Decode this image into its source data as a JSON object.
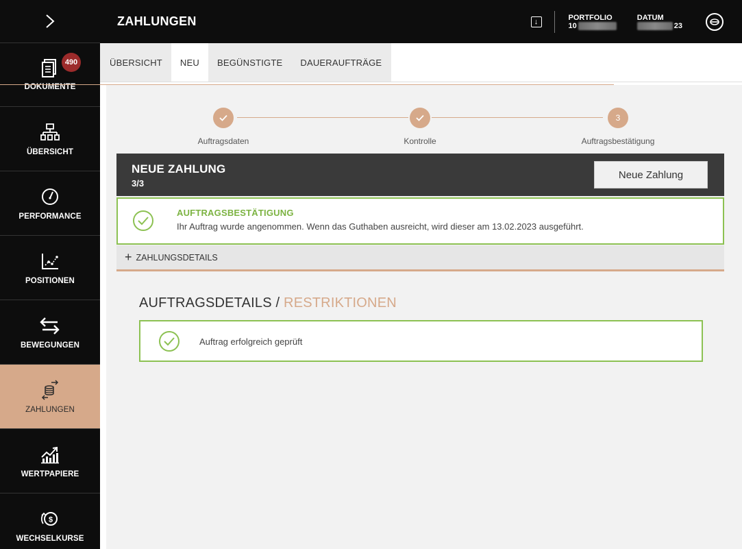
{
  "app": {
    "section_title": "ZAHLUNGEN"
  },
  "sidebar": {
    "badge_count": "490",
    "items": [
      {
        "label": "DOKUMENTE",
        "icon": "document-icon"
      },
      {
        "label": "ÜBERSICHT",
        "icon": "hierarchy-icon"
      },
      {
        "label": "PERFORMANCE",
        "icon": "gauge-icon"
      },
      {
        "label": "POSITIONEN",
        "icon": "line-chart-icon"
      },
      {
        "label": "BEWEGUNGEN",
        "icon": "transfer-arrows-icon"
      },
      {
        "label": "ZAHLUNGEN",
        "icon": "coins-exchange-icon"
      },
      {
        "label": "WERTPAPIERE",
        "icon": "securities-chart-icon"
      },
      {
        "label": "WECHSELKURSE",
        "icon": "currency-exchange-icon"
      }
    ],
    "active_item": "ZAHLUNGEN",
    "accent_color": "#d6a98a"
  },
  "topbar": {
    "portfolio_label": "PORTFOLIO",
    "portfolio_value_visible": "10",
    "datum_label": "DATUM",
    "datum_value_visible": "23"
  },
  "tabs": [
    {
      "label": "ÜBERSICHT",
      "active": false
    },
    {
      "label": "NEU",
      "active": true
    },
    {
      "label": "BEGÜNSTIGTE",
      "active": false
    },
    {
      "label": "DAUERAUFTRÄGE",
      "active": false
    }
  ],
  "stepper": {
    "steps": [
      {
        "label": "Auftragsdaten",
        "state": "done"
      },
      {
        "label": "Kontrolle",
        "state": "done"
      },
      {
        "label": "Auftragsbestätigung",
        "state": "current",
        "number": "3"
      }
    ]
  },
  "panel": {
    "title": "NEUE ZAHLUNG",
    "step_counter": "3/3",
    "new_payment_button": "Neue Zahlung"
  },
  "confirmation": {
    "title": "AUFTRAGSBESTÄTIGUNG",
    "message": "Ihr Auftrag wurde angenommen. Wenn das Guthaben ausreicht, wird dieser am 13.02.2023 ausgeführt.",
    "color": "#8cc152"
  },
  "details": {
    "label": "ZAHLUNGSDETAILS"
  },
  "order_details": {
    "title_main": "AUFTRAGSDETAILS / ",
    "title_accent": "RESTRIKTIONEN",
    "check_message": "Auftrag erfolgreich geprüft"
  }
}
